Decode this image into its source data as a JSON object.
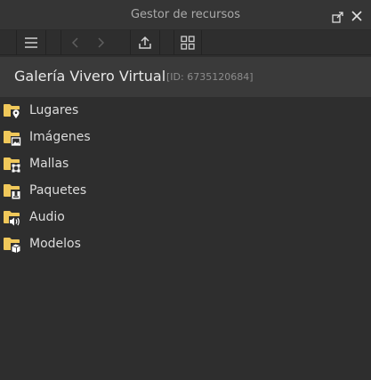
{
  "window": {
    "title": "Gestor de recursos"
  },
  "toolbar": {
    "buttons": [
      "menu-icon",
      "back-icon",
      "forward-icon",
      "upload-icon",
      "grid-view-icon"
    ]
  },
  "header": {
    "place_name": "Galería Vivero Virtual",
    "place_id": "[ID: 6735120684]"
  },
  "folders": [
    {
      "label": "Lugares",
      "icon": "folder-place-icon"
    },
    {
      "label": "Imágenes",
      "icon": "folder-image-icon"
    },
    {
      "label": "Mallas",
      "icon": "folder-mesh-icon"
    },
    {
      "label": "Paquetes",
      "icon": "folder-package-icon"
    },
    {
      "label": "Audio",
      "icon": "folder-audio-icon"
    },
    {
      "label": "Modelos",
      "icon": "folder-model-icon"
    }
  ],
  "colors": {
    "folder": "#f0c85a",
    "background": "#2e2e2e",
    "header": "#3a3a3a"
  }
}
